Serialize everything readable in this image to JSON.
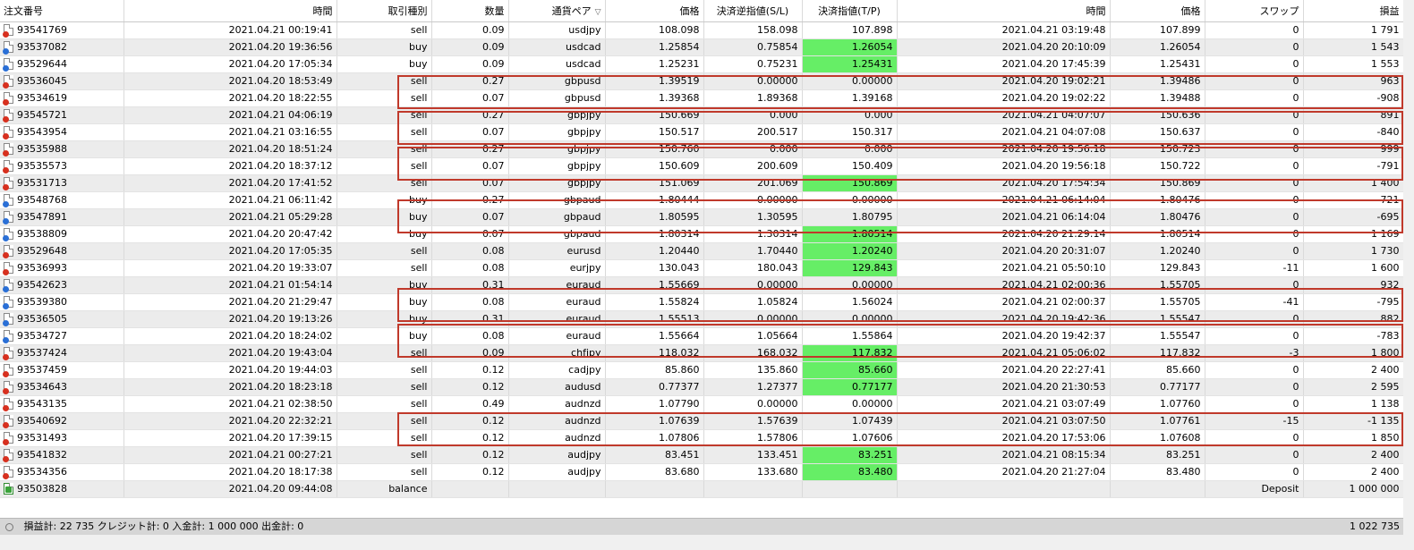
{
  "columns": [
    "注文番号",
    "時間",
    "取引種別",
    "数量",
    "通貨ペア",
    "価格",
    "決済逆指値(S/L)",
    "決済指値(T/P)",
    "時間",
    "価格",
    "スワップ",
    "損益"
  ],
  "sort_indicator": "▽",
  "rows": [
    {
      "ticket": "93541769",
      "open_time": "2021.04.21 00:19:41",
      "type": "sell",
      "volume": "0.09",
      "symbol": "usdjpy",
      "open_price": "108.098",
      "sl": "158.098",
      "tp": "107.898",
      "close_time": "2021.04.21 03:19:48",
      "close_price": "107.899",
      "swap": "0",
      "profit": "1 791",
      "tp_hit": false
    },
    {
      "ticket": "93537082",
      "open_time": "2021.04.20 19:36:56",
      "type": "buy",
      "volume": "0.09",
      "symbol": "usdcad",
      "open_price": "1.25854",
      "sl": "0.75854",
      "tp": "1.26054",
      "close_time": "2021.04.20 20:10:09",
      "close_price": "1.26054",
      "swap": "0",
      "profit": "1 543",
      "tp_hit": true
    },
    {
      "ticket": "93529644",
      "open_time": "2021.04.20 17:05:34",
      "type": "buy",
      "volume": "0.09",
      "symbol": "usdcad",
      "open_price": "1.25231",
      "sl": "0.75231",
      "tp": "1.25431",
      "close_time": "2021.04.20 17:45:39",
      "close_price": "1.25431",
      "swap": "0",
      "profit": "1 553",
      "tp_hit": true
    },
    {
      "ticket": "93536045",
      "open_time": "2021.04.20 18:53:49",
      "type": "sell",
      "volume": "0.27",
      "symbol": "gbpusd",
      "open_price": "1.39519",
      "sl": "0.00000",
      "tp": "0.00000",
      "close_time": "2021.04.20 19:02:21",
      "close_price": "1.39486",
      "swap": "0",
      "profit": "963",
      "tp_hit": false
    },
    {
      "ticket": "93534619",
      "open_time": "2021.04.20 18:22:55",
      "type": "sell",
      "volume": "0.07",
      "symbol": "gbpusd",
      "open_price": "1.39368",
      "sl": "1.89368",
      "tp": "1.39168",
      "close_time": "2021.04.20 19:02:22",
      "close_price": "1.39488",
      "swap": "0",
      "profit": "-908",
      "tp_hit": false
    },
    {
      "ticket": "93545721",
      "open_time": "2021.04.21 04:06:19",
      "type": "sell",
      "volume": "0.27",
      "symbol": "gbpjpy",
      "open_price": "150.669",
      "sl": "0.000",
      "tp": "0.000",
      "close_time": "2021.04.21 04:07:07",
      "close_price": "150.636",
      "swap": "0",
      "profit": "891",
      "tp_hit": false
    },
    {
      "ticket": "93543954",
      "open_time": "2021.04.21 03:16:55",
      "type": "sell",
      "volume": "0.07",
      "symbol": "gbpjpy",
      "open_price": "150.517",
      "sl": "200.517",
      "tp": "150.317",
      "close_time": "2021.04.21 04:07:08",
      "close_price": "150.637",
      "swap": "0",
      "profit": "-840",
      "tp_hit": false
    },
    {
      "ticket": "93535988",
      "open_time": "2021.04.20 18:51:24",
      "type": "sell",
      "volume": "0.27",
      "symbol": "gbpjpy",
      "open_price": "150.760",
      "sl": "0.000",
      "tp": "0.000",
      "close_time": "2021.04.20 19:56:18",
      "close_price": "150.723",
      "swap": "0",
      "profit": "999",
      "tp_hit": false
    },
    {
      "ticket": "93535573",
      "open_time": "2021.04.20 18:37:12",
      "type": "sell",
      "volume": "0.07",
      "symbol": "gbpjpy",
      "open_price": "150.609",
      "sl": "200.609",
      "tp": "150.409",
      "close_time": "2021.04.20 19:56:18",
      "close_price": "150.722",
      "swap": "0",
      "profit": "-791",
      "tp_hit": false
    },
    {
      "ticket": "93531713",
      "open_time": "2021.04.20 17:41:52",
      "type": "sell",
      "volume": "0.07",
      "symbol": "gbpjpy",
      "open_price": "151.069",
      "sl": "201.069",
      "tp": "150.869",
      "close_time": "2021.04.20 17:54:34",
      "close_price": "150.869",
      "swap": "0",
      "profit": "1 400",
      "tp_hit": true
    },
    {
      "ticket": "93548768",
      "open_time": "2021.04.21 06:11:42",
      "type": "buy",
      "volume": "0.27",
      "symbol": "gbpaud",
      "open_price": "1.80444",
      "sl": "0.00000",
      "tp": "0.00000",
      "close_time": "2021.04.21 06:14:04",
      "close_price": "1.80476",
      "swap": "0",
      "profit": "721",
      "tp_hit": false
    },
    {
      "ticket": "93547891",
      "open_time": "2021.04.21 05:29:28",
      "type": "buy",
      "volume": "0.07",
      "symbol": "gbpaud",
      "open_price": "1.80595",
      "sl": "1.30595",
      "tp": "1.80795",
      "close_time": "2021.04.21 06:14:04",
      "close_price": "1.80476",
      "swap": "0",
      "profit": "-695",
      "tp_hit": false
    },
    {
      "ticket": "93538809",
      "open_time": "2021.04.20 20:47:42",
      "type": "buy",
      "volume": "0.07",
      "symbol": "gbpaud",
      "open_price": "1.80314",
      "sl": "1.30314",
      "tp": "1.80514",
      "close_time": "2021.04.20 21:29:14",
      "close_price": "1.80514",
      "swap": "0",
      "profit": "1 169",
      "tp_hit": true
    },
    {
      "ticket": "93529648",
      "open_time": "2021.04.20 17:05:35",
      "type": "sell",
      "volume": "0.08",
      "symbol": "eurusd",
      "open_price": "1.20440",
      "sl": "1.70440",
      "tp": "1.20240",
      "close_time": "2021.04.20 20:31:07",
      "close_price": "1.20240",
      "swap": "0",
      "profit": "1 730",
      "tp_hit": true
    },
    {
      "ticket": "93536993",
      "open_time": "2021.04.20 19:33:07",
      "type": "sell",
      "volume": "0.08",
      "symbol": "eurjpy",
      "open_price": "130.043",
      "sl": "180.043",
      "tp": "129.843",
      "close_time": "2021.04.21 05:50:10",
      "close_price": "129.843",
      "swap": "-11",
      "profit": "1 600",
      "tp_hit": true
    },
    {
      "ticket": "93542623",
      "open_time": "2021.04.21 01:54:14",
      "type": "buy",
      "volume": "0.31",
      "symbol": "euraud",
      "open_price": "1.55669",
      "sl": "0.00000",
      "tp": "0.00000",
      "close_time": "2021.04.21 02:00:36",
      "close_price": "1.55705",
      "swap": "0",
      "profit": "932",
      "tp_hit": false
    },
    {
      "ticket": "93539380",
      "open_time": "2021.04.20 21:29:47",
      "type": "buy",
      "volume": "0.08",
      "symbol": "euraud",
      "open_price": "1.55824",
      "sl": "1.05824",
      "tp": "1.56024",
      "close_time": "2021.04.21 02:00:37",
      "close_price": "1.55705",
      "swap": "-41",
      "profit": "-795",
      "tp_hit": false
    },
    {
      "ticket": "93536505",
      "open_time": "2021.04.20 19:13:26",
      "type": "buy",
      "volume": "0.31",
      "symbol": "euraud",
      "open_price": "1.55513",
      "sl": "0.00000",
      "tp": "0.00000",
      "close_time": "2021.04.20 19:42:36",
      "close_price": "1.55547",
      "swap": "0",
      "profit": "882",
      "tp_hit": false
    },
    {
      "ticket": "93534727",
      "open_time": "2021.04.20 18:24:02",
      "type": "buy",
      "volume": "0.08",
      "symbol": "euraud",
      "open_price": "1.55664",
      "sl": "1.05664",
      "tp": "1.55864",
      "close_time": "2021.04.20 19:42:37",
      "close_price": "1.55547",
      "swap": "0",
      "profit": "-783",
      "tp_hit": false
    },
    {
      "ticket": "93537424",
      "open_time": "2021.04.20 19:43:04",
      "type": "sell",
      "volume": "0.09",
      "symbol": "chfjpy",
      "open_price": "118.032",
      "sl": "168.032",
      "tp": "117.832",
      "close_time": "2021.04.21 05:06:02",
      "close_price": "117.832",
      "swap": "-3",
      "profit": "1 800",
      "tp_hit": true
    },
    {
      "ticket": "93537459",
      "open_time": "2021.04.20 19:44:03",
      "type": "sell",
      "volume": "0.12",
      "symbol": "cadjpy",
      "open_price": "85.860",
      "sl": "135.860",
      "tp": "85.660",
      "close_time": "2021.04.20 22:27:41",
      "close_price": "85.660",
      "swap": "0",
      "profit": "2 400",
      "tp_hit": true
    },
    {
      "ticket": "93534643",
      "open_time": "2021.04.20 18:23:18",
      "type": "sell",
      "volume": "0.12",
      "symbol": "audusd",
      "open_price": "0.77377",
      "sl": "1.27377",
      "tp": "0.77177",
      "close_time": "2021.04.20 21:30:53",
      "close_price": "0.77177",
      "swap": "0",
      "profit": "2 595",
      "tp_hit": true
    },
    {
      "ticket": "93543135",
      "open_time": "2021.04.21 02:38:50",
      "type": "sell",
      "volume": "0.49",
      "symbol": "audnzd",
      "open_price": "1.07790",
      "sl": "0.00000",
      "tp": "0.00000",
      "close_time": "2021.04.21 03:07:49",
      "close_price": "1.07760",
      "swap": "0",
      "profit": "1 138",
      "tp_hit": false
    },
    {
      "ticket": "93540692",
      "open_time": "2021.04.20 22:32:21",
      "type": "sell",
      "volume": "0.12",
      "symbol": "audnzd",
      "open_price": "1.07639",
      "sl": "1.57639",
      "tp": "1.07439",
      "close_time": "2021.04.21 03:07:50",
      "close_price": "1.07761",
      "swap": "-15",
      "profit": "-1 135",
      "tp_hit": false
    },
    {
      "ticket": "93531493",
      "open_time": "2021.04.20 17:39:15",
      "type": "sell",
      "volume": "0.12",
      "symbol": "audnzd",
      "open_price": "1.07806",
      "sl": "1.57806",
      "tp": "1.07606",
      "close_time": "2021.04.20 17:53:06",
      "close_price": "1.07608",
      "swap": "0",
      "profit": "1 850",
      "tp_hit": false
    },
    {
      "ticket": "93541832",
      "open_time": "2021.04.21 00:27:21",
      "type": "sell",
      "volume": "0.12",
      "symbol": "audjpy",
      "open_price": "83.451",
      "sl": "133.451",
      "tp": "83.251",
      "close_time": "2021.04.21 08:15:34",
      "close_price": "83.251",
      "swap": "0",
      "profit": "2 400",
      "tp_hit": true
    },
    {
      "ticket": "93534356",
      "open_time": "2021.04.20 18:17:38",
      "type": "sell",
      "volume": "0.12",
      "symbol": "audjpy",
      "open_price": "83.680",
      "sl": "133.680",
      "tp": "83.480",
      "close_time": "2021.04.20 21:27:04",
      "close_price": "83.480",
      "swap": "0",
      "profit": "2 400",
      "tp_hit": true
    }
  ],
  "balance_row": {
    "ticket": "93503828",
    "time": "2021.04.20 09:44:08",
    "type": "balance",
    "comment": "Deposit",
    "amount": "1 000 000"
  },
  "status": {
    "summary": "損益計: 22 735  クレジット計: 0  入金計: 1 000 000  出金計: 0",
    "total": "1 022 735"
  },
  "colors": {
    "tp_hit_bg": "#66ee66",
    "highlight_box": "#c0392b",
    "sell_icon": "#d7301f",
    "buy_icon": "#2a6fd6"
  }
}
